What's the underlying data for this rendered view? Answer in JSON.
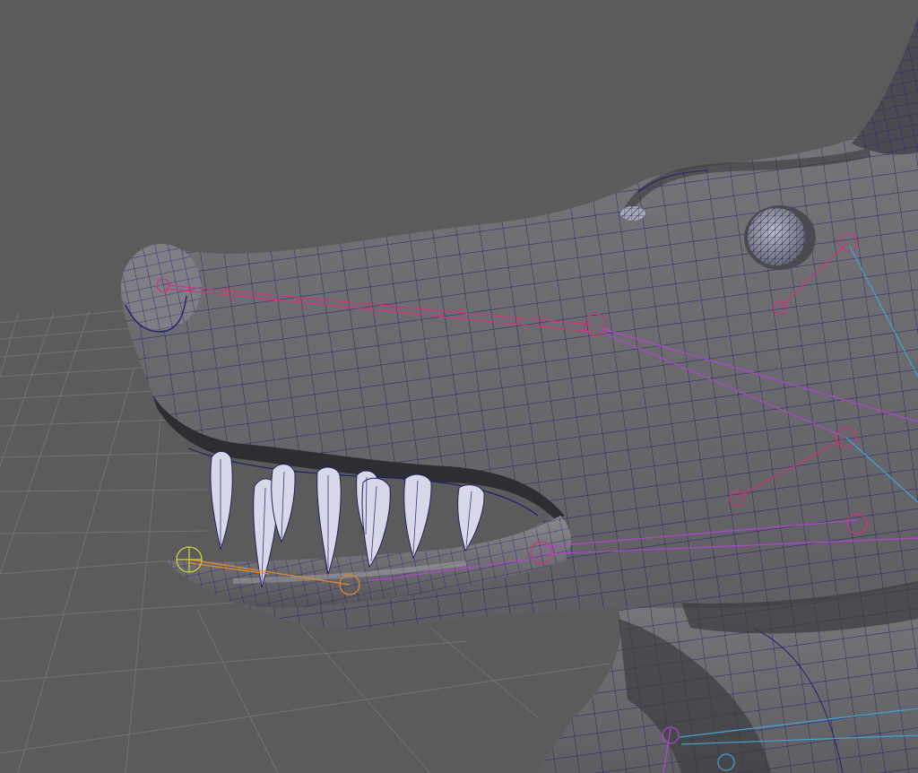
{
  "viewport": {
    "kind": "3d-modeling-viewport",
    "background_color": "#5b5b5b",
    "grid_color": "#727272",
    "wireframe_color": "#1f1f6e",
    "mesh_fill": "#6e6e72",
    "mesh_shadow": "#3a3a3e",
    "teeth_fill": "#d8d8ea",
    "joint_colors": {
      "pink": "#d2337a",
      "magenta": "#b344d1",
      "orange": "#e58a2a",
      "yellow": "#d8d23a",
      "cyan": "#3fa6d6"
    }
  }
}
